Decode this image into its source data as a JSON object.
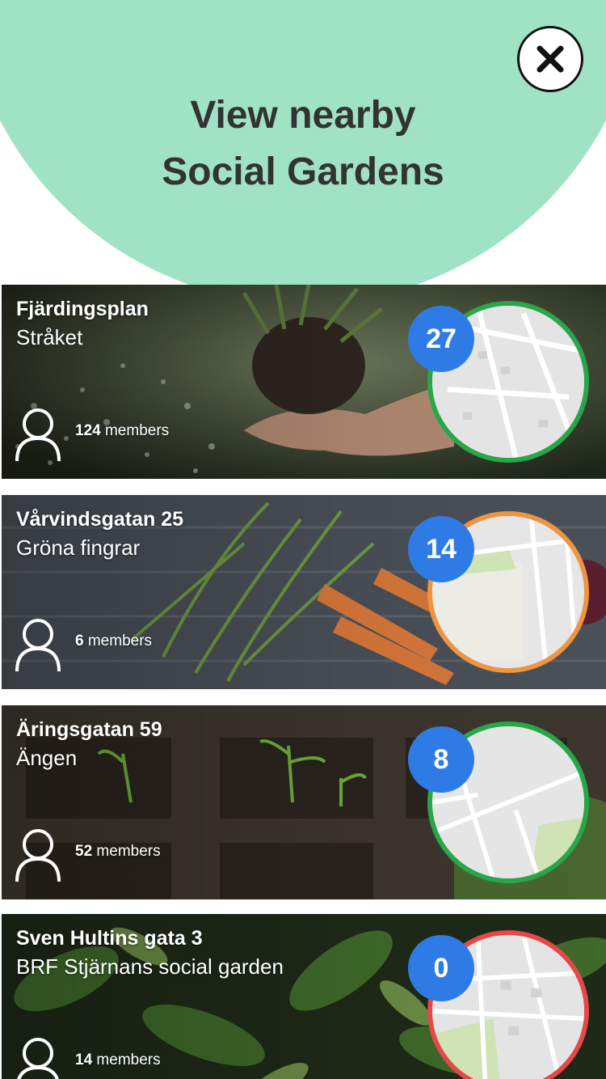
{
  "header": {
    "title_line1": "View nearby",
    "title_line2": "Social Gardens",
    "background_color": "#a0e2c6",
    "close_icon": "close-icon"
  },
  "gardens": [
    {
      "address": "Fjärdingsplan",
      "name": "Stråket",
      "member_count": "124",
      "members_label": "members",
      "active_count": "27",
      "ring_color": "#27a74a"
    },
    {
      "address": "Vårvindsgatan 25",
      "name": "Gröna fingrar",
      "member_count": "6",
      "members_label": "members",
      "active_count": "14",
      "ring_color": "#ef9440"
    },
    {
      "address": "Äringsgatan 59",
      "name": "Ängen",
      "member_count": "52",
      "members_label": "members",
      "active_count": "8",
      "ring_color": "#27a74a"
    },
    {
      "address": "Sven Hultins gata 3",
      "name": "BRF Stjärnans social garden",
      "member_count": "14",
      "members_label": "members",
      "active_count": "0",
      "ring_color": "#e54848"
    }
  ],
  "colors": {
    "badge": "#2f7be6",
    "title_text": "#333333"
  }
}
